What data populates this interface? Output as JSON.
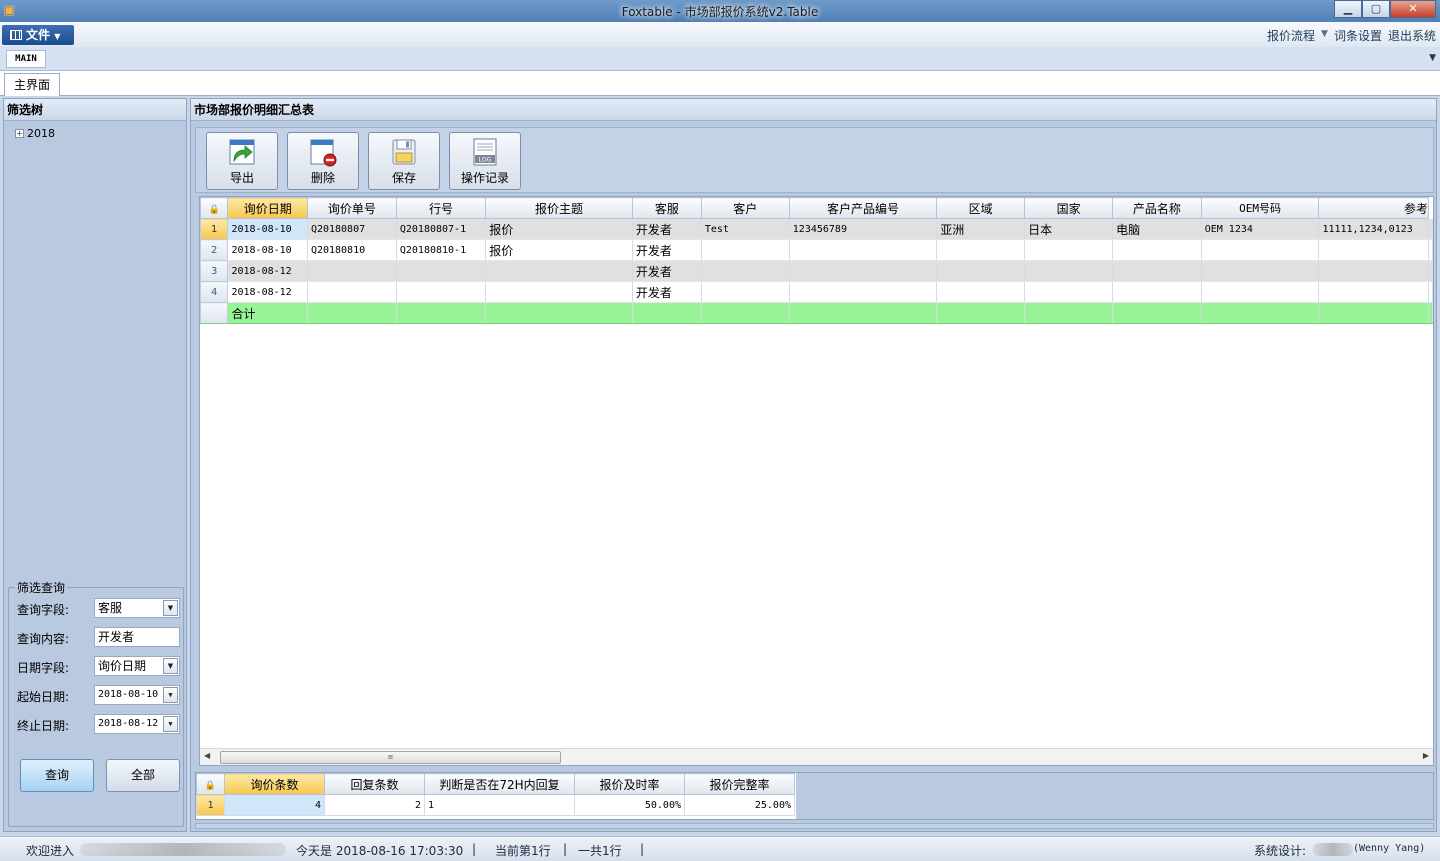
{
  "window": {
    "title": "Foxtable - 市场部报价系统v2.Table",
    "minimize": "▁",
    "maximize": "▢",
    "close": "✕"
  },
  "menu": {
    "file_label": "文件",
    "links": [
      "报价流程",
      "词条设置",
      "退出系统"
    ]
  },
  "ribbon": {
    "tab": "MAIN"
  },
  "page_tab": "主界面",
  "left": {
    "tree_title": "筛选树",
    "tree_root": "2018",
    "filter_title": "筛选查询",
    "fields": [
      {
        "label": "查询字段:",
        "value": "客服"
      },
      {
        "label": "查询内容:",
        "value": "开发者"
      },
      {
        "label": "日期字段:",
        "value": "询价日期"
      },
      {
        "label": "起始日期:",
        "value": "2018-08-10"
      },
      {
        "label": "终止日期:",
        "value": "2018-08-12"
      }
    ],
    "query_button": "查询",
    "all_button": "全部"
  },
  "main": {
    "title": "市场部报价明细汇总表",
    "toolbar": [
      {
        "label": "导出",
        "icon": "export-icon"
      },
      {
        "label": "删除",
        "icon": "delete-icon"
      },
      {
        "label": "保存",
        "icon": "save-icon"
      },
      {
        "label": "操作记录",
        "icon": "log-icon"
      }
    ],
    "log_icon_text": "LOG",
    "columns": [
      "询价日期",
      "询价单号",
      "行号",
      "报价主题",
      "客服",
      "客户",
      "客户产品编号",
      "区域",
      "国家",
      "产品名称",
      "OEM号码",
      "参考"
    ],
    "rows": [
      {
        "num": "1",
        "cells": [
          "2018-08-10",
          "Q20180807",
          "Q20180807-1",
          "报价",
          "开发者",
          "Test",
          "123456789",
          "亚洲",
          "日本",
          "电脑",
          "OEM 1234",
          "11111,1234,0123"
        ]
      },
      {
        "num": "2",
        "cells": [
          "2018-08-10",
          "Q20180810",
          "Q20180810-1",
          "报价",
          "开发者",
          "",
          "",
          "",
          "",
          "",
          "",
          ""
        ]
      },
      {
        "num": "3",
        "cells": [
          "2018-08-12",
          "",
          "",
          "",
          "开发者",
          "",
          "",
          "",
          "",
          "",
          "",
          ""
        ]
      },
      {
        "num": "4",
        "cells": [
          "2018-08-12",
          "",
          "",
          "",
          "开发者",
          "",
          "",
          "",
          "",
          "",
          "",
          ""
        ]
      }
    ],
    "total_label": "合计",
    "summary": {
      "columns": [
        "询价条数",
        "回复条数",
        "判断是否在72H内回复",
        "报价及时率",
        "报价完整率"
      ],
      "row": {
        "num": "1",
        "cells": [
          "4",
          "2",
          "1",
          "50.00%",
          "25.00%"
        ]
      }
    }
  },
  "status": {
    "welcome": "欢迎进入",
    "today": "今天是 2018-08-16 17:03:30",
    "sep": "|",
    "current_row": "当前第1行",
    "total_rows": "一共1行",
    "designer_label": "系统设计:",
    "designer_name": "(Wenny Yang)"
  }
}
